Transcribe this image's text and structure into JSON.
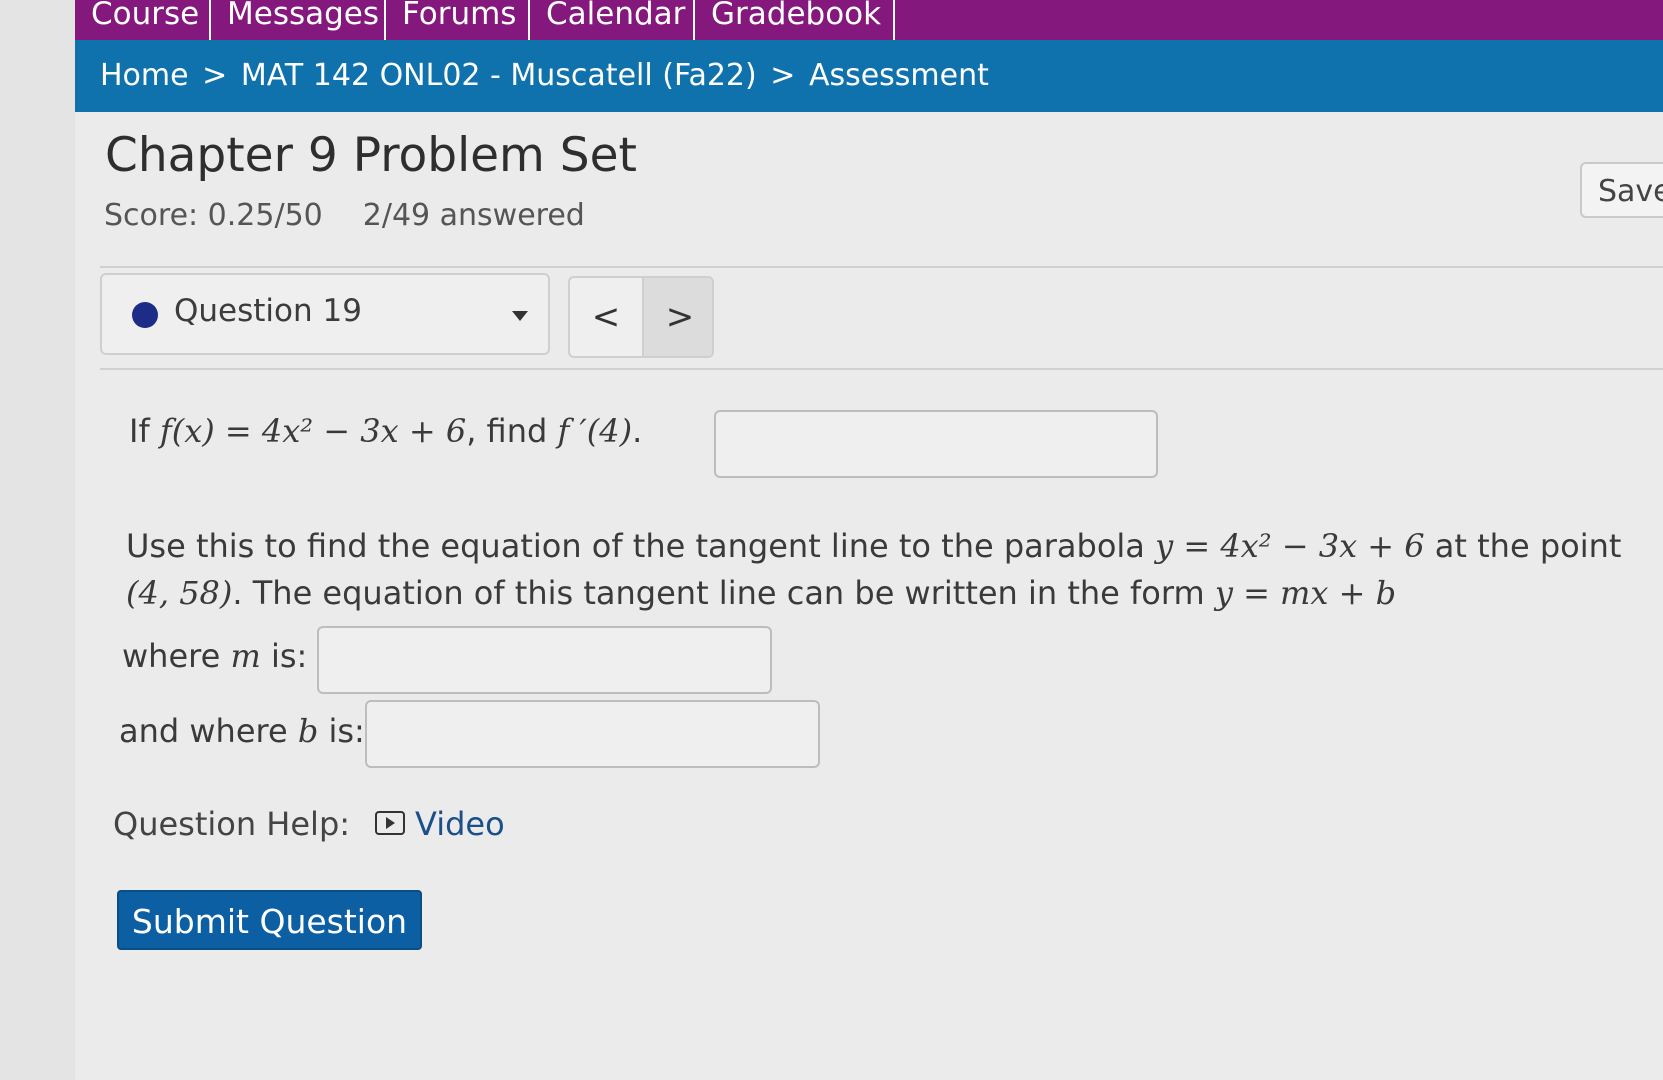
{
  "topnav": {
    "tabs": [
      "Course",
      "Messages",
      "Forums",
      "Calendar",
      "Gradebook"
    ]
  },
  "breadcrumb": {
    "home": "Home",
    "course": "MAT 142 ONL02 - Muscatell (Fa22)",
    "current": "Assessment",
    "separator": ">"
  },
  "assessment": {
    "title": "Chapter 9 Problem Set",
    "score": "Score: 0.25/50",
    "answered": "2/49 answered",
    "save_label": "Save"
  },
  "question_nav": {
    "selected": "Question 19",
    "prev_symbol": "<",
    "next_symbol": ">"
  },
  "question": {
    "part1_prefix": "If ",
    "part1_func": "f(x) = 4x² − 3x + 6",
    "part1_mid": ", find ",
    "part1_target": "f ′(4)",
    "part1_end": ".",
    "part2_line1_text": "Use this to find the equation of the tangent line to the parabola ",
    "part2_line1_math": "y = 4x² − 3x + 6",
    "part2_line1_end": " at the point",
    "part2_line2_math": "(4, 58)",
    "part2_line2_text": ". The equation of this tangent line can be written in the form ",
    "part2_line2_form": "y = mx + b",
    "m_label_prefix": "where ",
    "m_var": "m",
    "m_label_suffix": " is:",
    "b_label_prefix": "and where ",
    "b_var": "b",
    "b_label_suffix": " is:"
  },
  "help": {
    "label": "Question Help:",
    "video_label": "Video"
  },
  "submit_label": "Submit Question",
  "colors": {
    "topnav": "#84187c",
    "breadcrumb_bar": "#0f72ac",
    "submit": "#0c5fa3",
    "question_dot": "#1d2c86"
  }
}
